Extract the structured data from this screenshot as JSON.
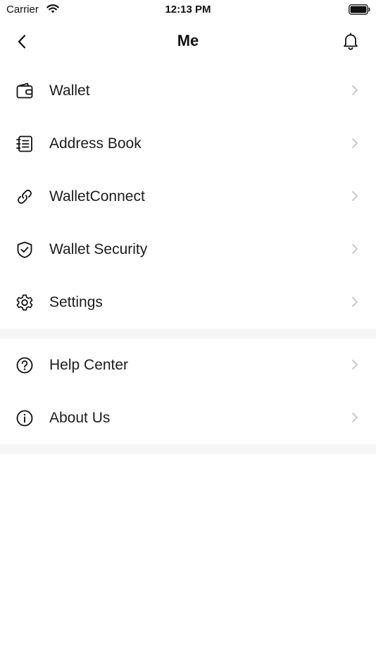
{
  "status_bar": {
    "carrier": "Carrier",
    "time": "12:13 PM"
  },
  "nav": {
    "title": "Me",
    "back_icon": "chevron-left-icon",
    "notification_icon": "bell-icon"
  },
  "menu_group_1": {
    "items": [
      {
        "label": "Wallet",
        "icon": "wallet-icon"
      },
      {
        "label": "Address Book",
        "icon": "address-book-icon"
      },
      {
        "label": "WalletConnect",
        "icon": "link-icon"
      },
      {
        "label": "Wallet Security",
        "icon": "shield-check-icon"
      },
      {
        "label": "Settings",
        "icon": "gear-icon"
      }
    ]
  },
  "menu_group_2": {
    "items": [
      {
        "label": "Help Center",
        "icon": "question-circle-icon"
      },
      {
        "label": "About Us",
        "icon": "info-circle-icon"
      }
    ]
  },
  "colors": {
    "text": "#1c1c1c",
    "chevron": "#c4c4c4",
    "separator": "#f6f6f6"
  }
}
